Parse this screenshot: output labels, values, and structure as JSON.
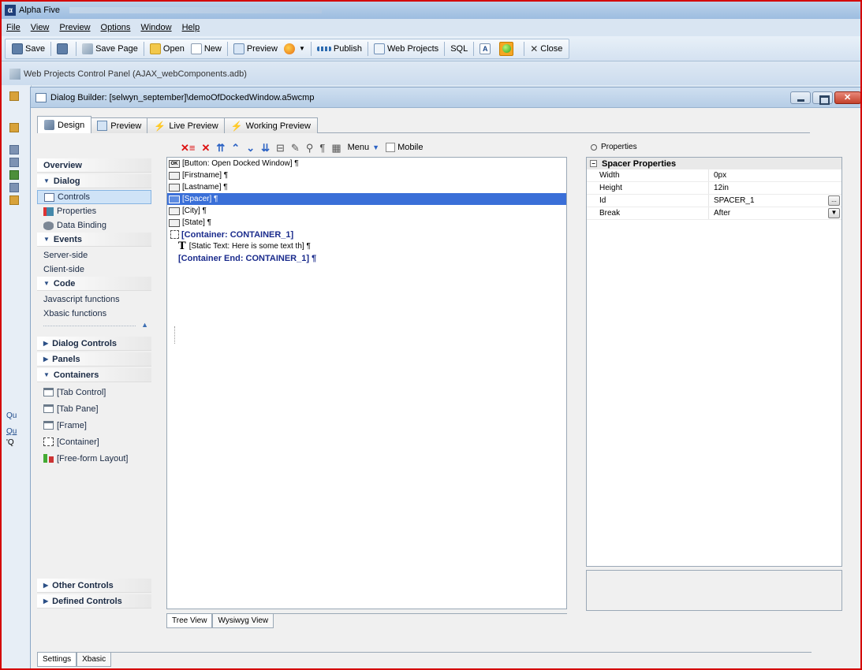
{
  "app": {
    "title": "Alpha Five",
    "logo_letter": "α"
  },
  "menu": [
    "File",
    "View",
    "Preview",
    "Options",
    "Window",
    "Help"
  ],
  "toolbar": {
    "save": "Save",
    "save_page": "Save Page",
    "open": "Open",
    "new": "New",
    "preview": "Preview",
    "publish": "Publish",
    "web_projects": "Web Projects",
    "sql": "SQL",
    "close": "Close"
  },
  "project_panel": {
    "title": "Web Projects Control Panel (AJAX_webComponents.adb)"
  },
  "dialog_builder": {
    "title": "Dialog Builder: [selwyn_september]\\demoOfDockedWindow.a5wcmp",
    "tabs": [
      "Design",
      "Preview",
      "Live Preview",
      "Working Preview"
    ]
  },
  "nav": {
    "overview": "Overview",
    "dialog": "Dialog",
    "controls": "Controls",
    "properties": "Properties",
    "data_binding": "Data Binding",
    "events": "Events",
    "server_side": "Server-side",
    "client_side": "Client-side",
    "code": "Code",
    "javascript_functions": "Javascript functions",
    "xbasic_functions": "Xbasic functions",
    "dialog_controls": "Dialog Controls",
    "panels": "Panels",
    "containers": "Containers",
    "tab_control": "[Tab Control]",
    "tab_pane": "[Tab Pane]",
    "frame": "[Frame]",
    "container": "[Container]",
    "free_form_layout": "[Free-form Layout]",
    "other_controls": "Other Controls",
    "defined_controls": "Defined Controls"
  },
  "editor_toolbar": {
    "menu_label": "Menu",
    "mobile_label": "Mobile"
  },
  "tree": {
    "rows": [
      {
        "text": "[Button: Open Docked Window] ¶",
        "type": "button"
      },
      {
        "text": "[Firstname] ¶",
        "type": "field"
      },
      {
        "text": "[Lastname] ¶",
        "type": "field"
      },
      {
        "text": "[Spacer] ¶",
        "type": "spacer",
        "selected": true
      },
      {
        "text": "[City] ¶",
        "type": "field"
      },
      {
        "text": "[State] ¶",
        "type": "field"
      },
      {
        "text": "[Container: CONTAINER_1]",
        "type": "container-start"
      },
      {
        "text": "[Static Text: Here is some text th] ¶",
        "type": "static"
      },
      {
        "text": "[Container End: CONTAINER_1] ¶",
        "type": "container-end"
      }
    ],
    "views": [
      "Tree View",
      "Wysiwyg View"
    ]
  },
  "properties": {
    "label": "Properties",
    "section": "Spacer Properties",
    "rows": [
      {
        "name": "Width",
        "value": "0px"
      },
      {
        "name": "Height",
        "value": "12in"
      },
      {
        "name": "Id",
        "value": "SPACER_1"
      },
      {
        "name": "Break",
        "value": "After"
      }
    ]
  },
  "bottom_tabs": [
    "Settings",
    "Xbasic"
  ],
  "side_strip": {
    "labels": [
      "Qu",
      "Qu",
      "'Q"
    ]
  }
}
